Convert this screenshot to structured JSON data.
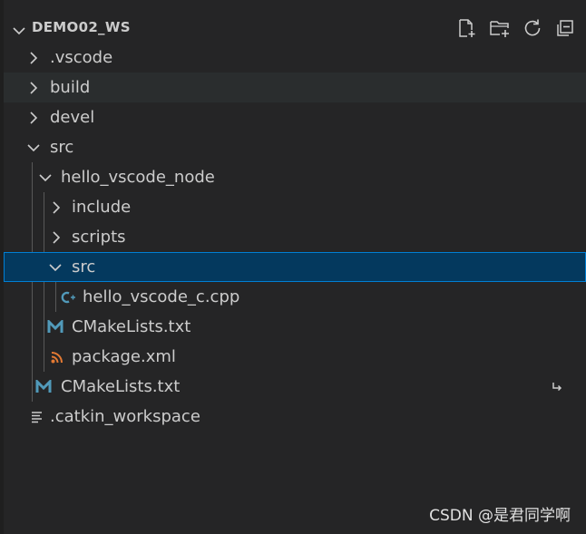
{
  "explorer": {
    "title": "DEMO02_WS",
    "actions": [
      {
        "name": "new-file",
        "icon": "new-file-icon"
      },
      {
        "name": "new-folder",
        "icon": "new-folder-icon"
      },
      {
        "name": "refresh",
        "icon": "refresh-icon"
      },
      {
        "name": "collapse-all",
        "icon": "collapse-all-icon"
      }
    ]
  },
  "tree": {
    "items": [
      {
        "label": ".vscode",
        "type": "folder",
        "expanded": false,
        "depth": 0
      },
      {
        "label": "build",
        "type": "folder",
        "expanded": false,
        "depth": 0
      },
      {
        "label": "devel",
        "type": "folder",
        "expanded": false,
        "depth": 0
      },
      {
        "label": "src",
        "type": "folder",
        "expanded": true,
        "depth": 0
      },
      {
        "label": "hello_vscode_node",
        "type": "folder",
        "expanded": true,
        "depth": 1
      },
      {
        "label": "include",
        "type": "folder",
        "expanded": false,
        "depth": 2
      },
      {
        "label": "scripts",
        "type": "folder",
        "expanded": false,
        "depth": 2
      },
      {
        "label": "src",
        "type": "folder",
        "expanded": true,
        "depth": 2,
        "selected": true
      },
      {
        "label": "hello_vscode_c.cpp",
        "type": "file",
        "icon": "cpp-icon",
        "depth": 3
      },
      {
        "label": "CMakeLists.txt",
        "type": "file",
        "icon": "cmake-icon",
        "depth": 2
      },
      {
        "label": "package.xml",
        "type": "file",
        "icon": "xml-rss-icon",
        "depth": 2
      },
      {
        "label": "CMakeLists.txt",
        "type": "file",
        "icon": "cmake-icon",
        "depth": 1,
        "decoration": "symlink-arrow-icon"
      },
      {
        "label": ".catkin_workspace",
        "type": "file",
        "icon": "text-lines-icon",
        "depth": 0
      }
    ]
  },
  "watermark": "CSDN @是君同学啊",
  "colors": {
    "background": "#252526",
    "selection": "#04395e",
    "selection_border": "#007fd4",
    "cmake": "#519aba",
    "xml": "#e37933",
    "cpp": "#519aba"
  }
}
